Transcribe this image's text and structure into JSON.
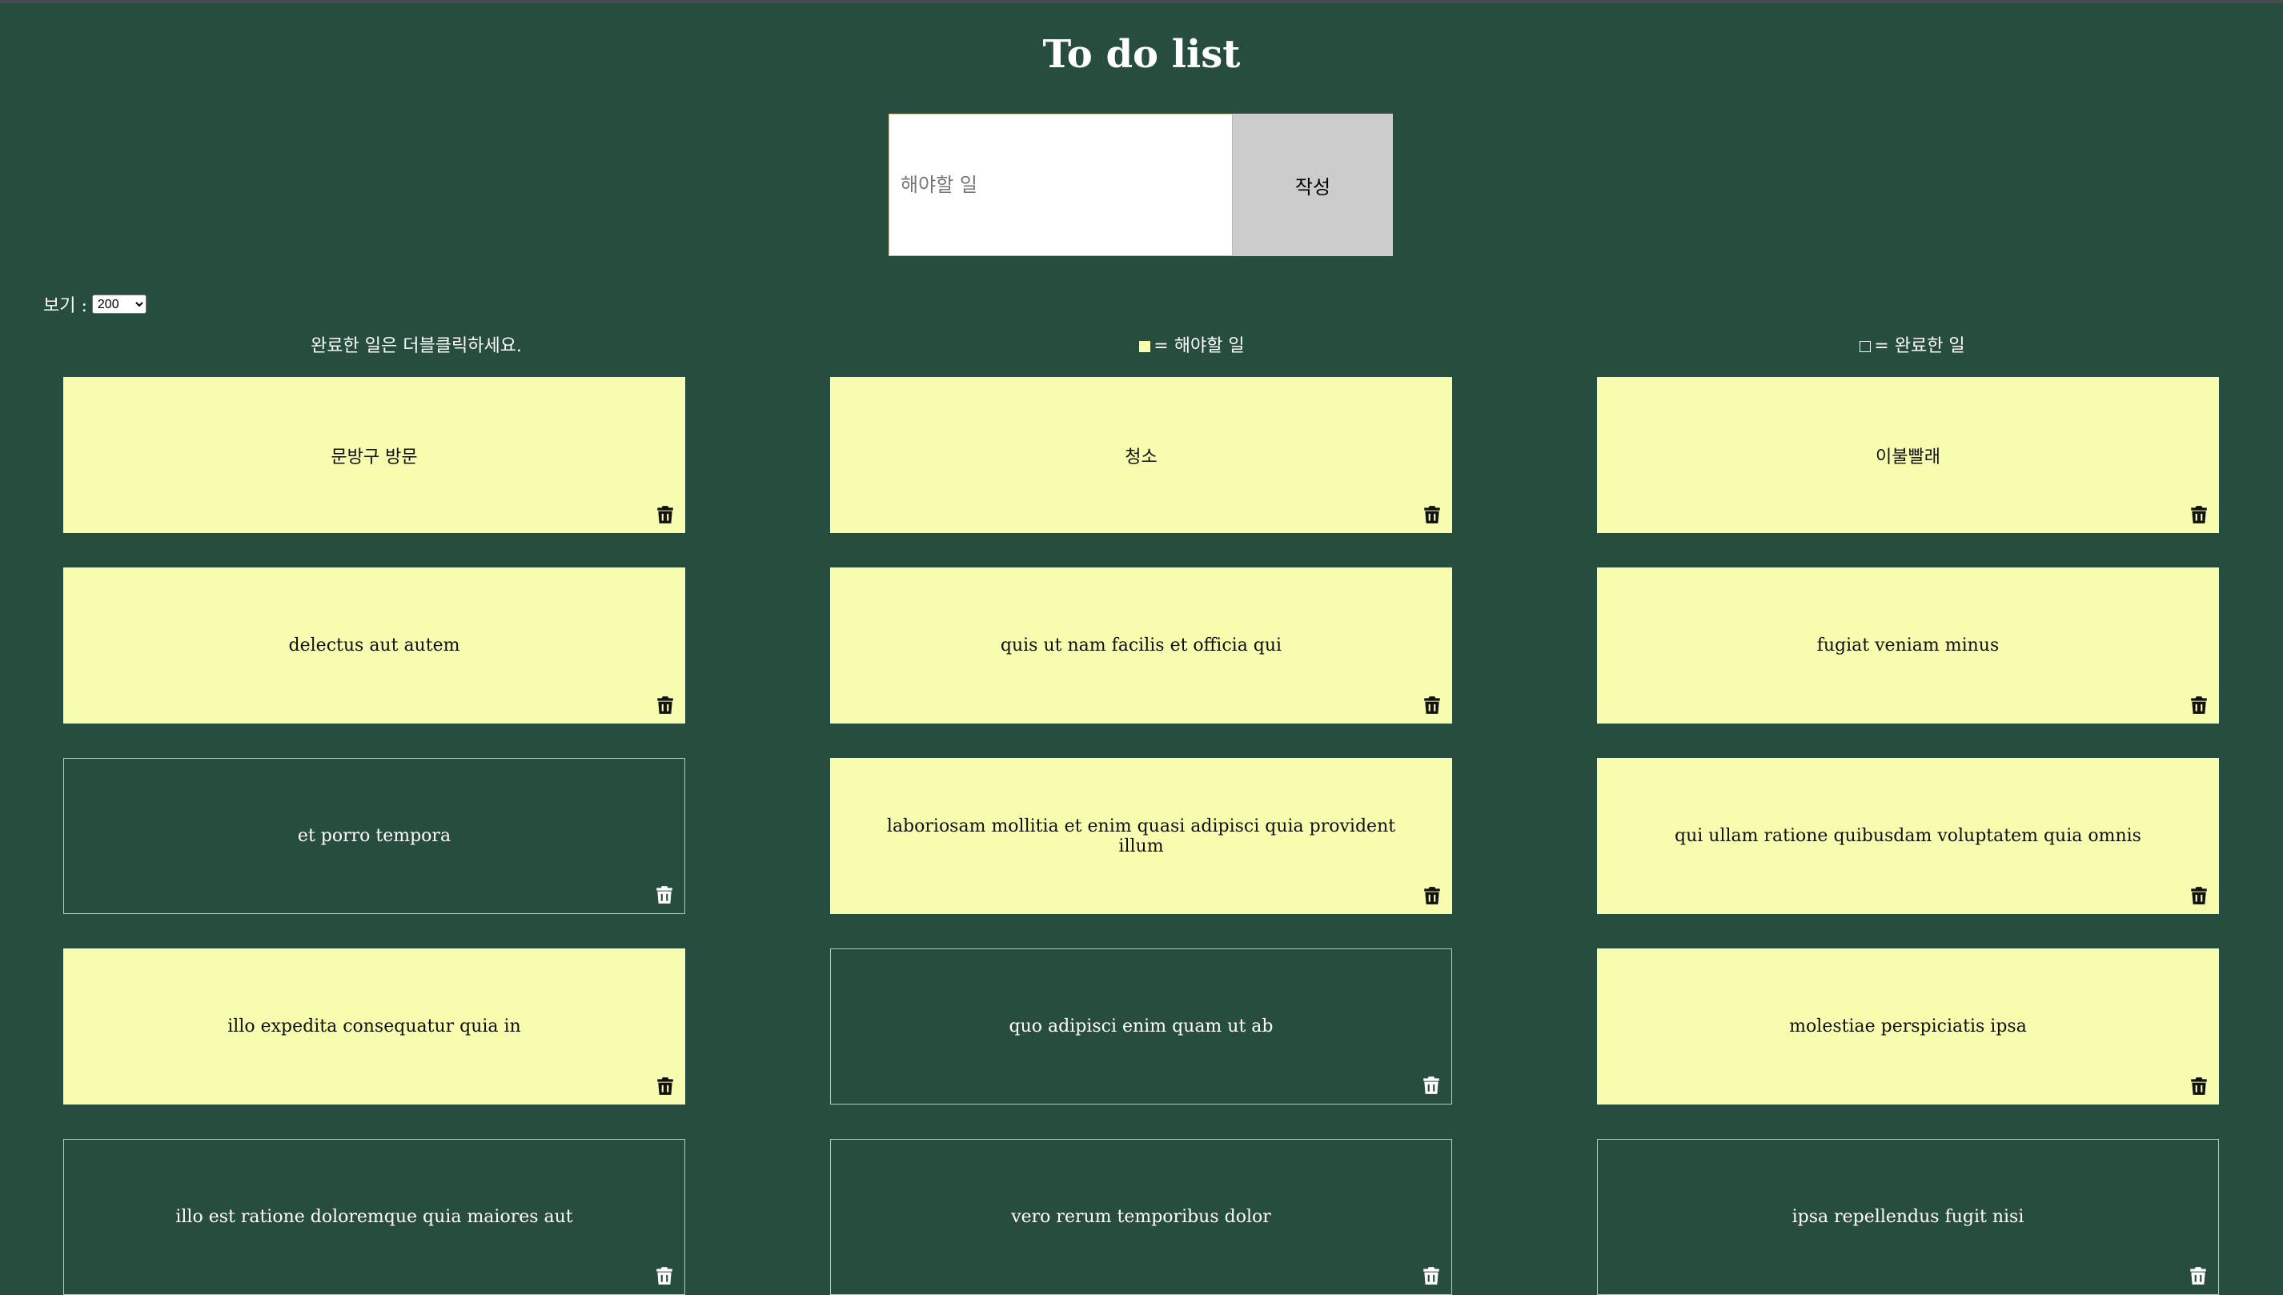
{
  "app": {
    "title": "To do list"
  },
  "form": {
    "placeholder": "해야할 일",
    "value": "",
    "submit_label": "작성"
  },
  "view": {
    "label": "보기 :",
    "selected": "200",
    "options": [
      "200"
    ]
  },
  "legend": {
    "hint": "완료한 일은 더블클릭하세요.",
    "todo_label": "= 해야할 일",
    "done_label": "= 완료한 일"
  },
  "colors": {
    "background": "#264d3d",
    "todo_card": "#f7fcae",
    "done_card_border": "#b8c9c0",
    "submit_button": "#cccccc"
  },
  "icons": {
    "delete": "trash-icon"
  },
  "todos": [
    {
      "text": "문방구 방문",
      "completed": false
    },
    {
      "text": "청소",
      "completed": false
    },
    {
      "text": "이불빨래",
      "completed": false
    },
    {
      "text": "delectus aut autem",
      "completed": false
    },
    {
      "text": "quis ut nam facilis et officia qui",
      "completed": false
    },
    {
      "text": "fugiat veniam minus",
      "completed": false
    },
    {
      "text": "et porro tempora",
      "completed": true
    },
    {
      "text": "laboriosam mollitia et enim quasi adipisci quia provident illum",
      "completed": false
    },
    {
      "text": "qui ullam ratione quibusdam voluptatem quia omnis",
      "completed": false
    },
    {
      "text": "illo expedita consequatur quia in",
      "completed": false
    },
    {
      "text": "quo adipisci enim quam ut ab",
      "completed": true
    },
    {
      "text": "molestiae perspiciatis ipsa",
      "completed": false
    },
    {
      "text": "illo est ratione doloremque quia maiores aut",
      "completed": true
    },
    {
      "text": "vero rerum temporibus dolor",
      "completed": true
    },
    {
      "text": "ipsa repellendus fugit nisi",
      "completed": true
    }
  ]
}
